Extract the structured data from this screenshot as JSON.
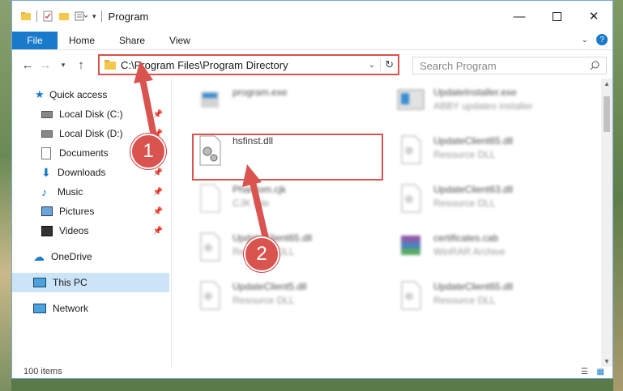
{
  "window": {
    "title": "Program"
  },
  "ribbon": {
    "file": "File",
    "tabs": [
      "Home",
      "Share",
      "View"
    ]
  },
  "address": {
    "path": "C:\\Program Files\\Program Directory"
  },
  "search": {
    "placeholder": "Search Program"
  },
  "nav": {
    "items": [
      {
        "label": "Quick access",
        "icon": "star-icon"
      },
      {
        "label": "Local Disk (C:)",
        "icon": "drive-icon",
        "pinned": true
      },
      {
        "label": "Local Disk (D:)",
        "icon": "drive-icon",
        "pinned": true
      },
      {
        "label": "Documents",
        "icon": "documents-icon",
        "pinned": true
      },
      {
        "label": "Downloads",
        "icon": "downloads-icon",
        "pinned": true
      },
      {
        "label": "Music",
        "icon": "music-icon",
        "pinned": true
      },
      {
        "label": "Pictures",
        "icon": "pictures-icon",
        "pinned": true
      },
      {
        "label": "Videos",
        "icon": "videos-icon",
        "pinned": true
      },
      {
        "label": "OneDrive",
        "icon": "cloud-icon"
      },
      {
        "label": "This PC",
        "icon": "computer-icon",
        "selected": true
      },
      {
        "label": "Network",
        "icon": "network-icon"
      }
    ]
  },
  "files": [
    {
      "name": "program.exe",
      "type": ""
    },
    {
      "name": "UpdateInstaller.exe",
      "type": "ABBY updates installer"
    },
    {
      "name": "hsfinst.dll",
      "type": ""
    },
    {
      "name": "UpdateClient65.dll",
      "type": "Resource DLL"
    },
    {
      "name": "Phantom.cjk",
      "type": "CJK File"
    },
    {
      "name": "UpdateClient63.dll",
      "type": "Resource DLL"
    },
    {
      "name": "UpdateClient65.dll",
      "type": "Resource DLL"
    },
    {
      "name": "certificates.cab",
      "type": "WinRAR Archive"
    },
    {
      "name": "UpdateClient5.dll",
      "type": "Resource DLL"
    },
    {
      "name": "UpdateClient65.dll",
      "type": "Resource DLL"
    }
  ],
  "status": {
    "count": "100 items"
  },
  "callouts": {
    "one": "1",
    "two": "2"
  },
  "colors": {
    "accent": "#1979ca",
    "highlight": "#d9534f",
    "selected": "#cce4f7"
  }
}
